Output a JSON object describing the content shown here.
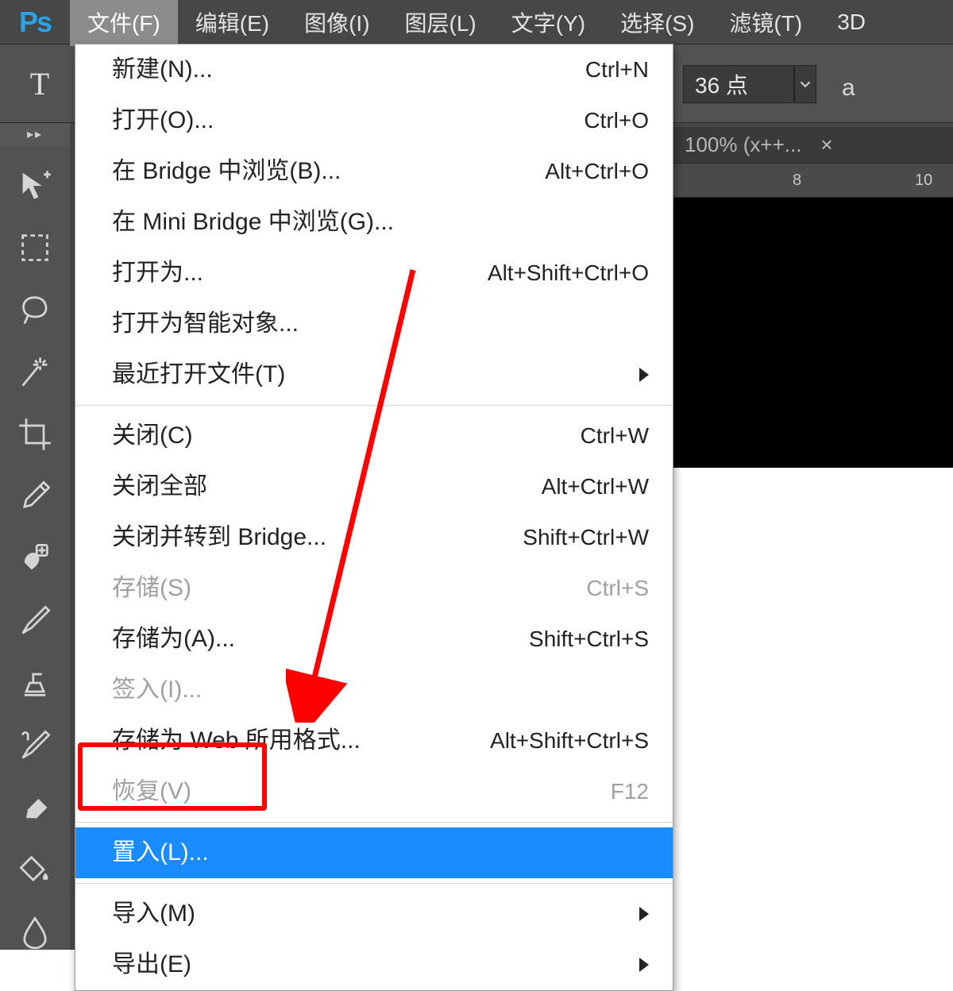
{
  "menubar": {
    "items": [
      "文件(F)",
      "编辑(E)",
      "图像(I)",
      "图层(L)",
      "文字(Y)",
      "选择(S)",
      "滤镜(T)",
      "3D"
    ]
  },
  "options": {
    "type_tool_label": "T",
    "font_size": "36 点",
    "aa_hint": "a"
  },
  "doc_tab": {
    "title": "100% (x++...",
    "close": "×"
  },
  "ruler": {
    "t8": "8",
    "t10": "10"
  },
  "file_menu": {
    "items": [
      {
        "label": "新建(N)...",
        "shortcut": "Ctrl+N",
        "disabled": false
      },
      {
        "label": "打开(O)...",
        "shortcut": "Ctrl+O",
        "disabled": false
      },
      {
        "label": "在 Bridge 中浏览(B)...",
        "shortcut": "Alt+Ctrl+O",
        "disabled": false
      },
      {
        "label": "在 Mini Bridge 中浏览(G)...",
        "shortcut": "",
        "disabled": false
      },
      {
        "label": "打开为...",
        "shortcut": "Alt+Shift+Ctrl+O",
        "disabled": false
      },
      {
        "label": "打开为智能对象...",
        "shortcut": "",
        "disabled": false
      },
      {
        "label": "最近打开文件(T)",
        "shortcut": "",
        "disabled": false,
        "submenu": true
      }
    ],
    "group2": [
      {
        "label": "关闭(C)",
        "shortcut": "Ctrl+W",
        "disabled": false
      },
      {
        "label": "关闭全部",
        "shortcut": "Alt+Ctrl+W",
        "disabled": false
      },
      {
        "label": "关闭并转到 Bridge...",
        "shortcut": "Shift+Ctrl+W",
        "disabled": false
      },
      {
        "label": "存储(S)",
        "shortcut": "Ctrl+S",
        "disabled": true
      },
      {
        "label": "存储为(A)...",
        "shortcut": "Shift+Ctrl+S",
        "disabled": false
      },
      {
        "label": "签入(I)...",
        "shortcut": "",
        "disabled": true
      },
      {
        "label": "存储为 Web 所用格式...",
        "shortcut": "Alt+Shift+Ctrl+S",
        "disabled": false
      },
      {
        "label": "恢复(V)",
        "shortcut": "F12",
        "disabled": true
      }
    ],
    "group3": [
      {
        "label": "置入(L)...",
        "shortcut": "",
        "disabled": false,
        "selected": true
      }
    ],
    "group4": [
      {
        "label": "导入(M)",
        "shortcut": "",
        "disabled": false,
        "submenu": true
      },
      {
        "label": "导出(E)",
        "shortcut": "",
        "disabled": false,
        "submenu": true
      }
    ]
  },
  "sidebar": {
    "toggle": "▸▸"
  }
}
